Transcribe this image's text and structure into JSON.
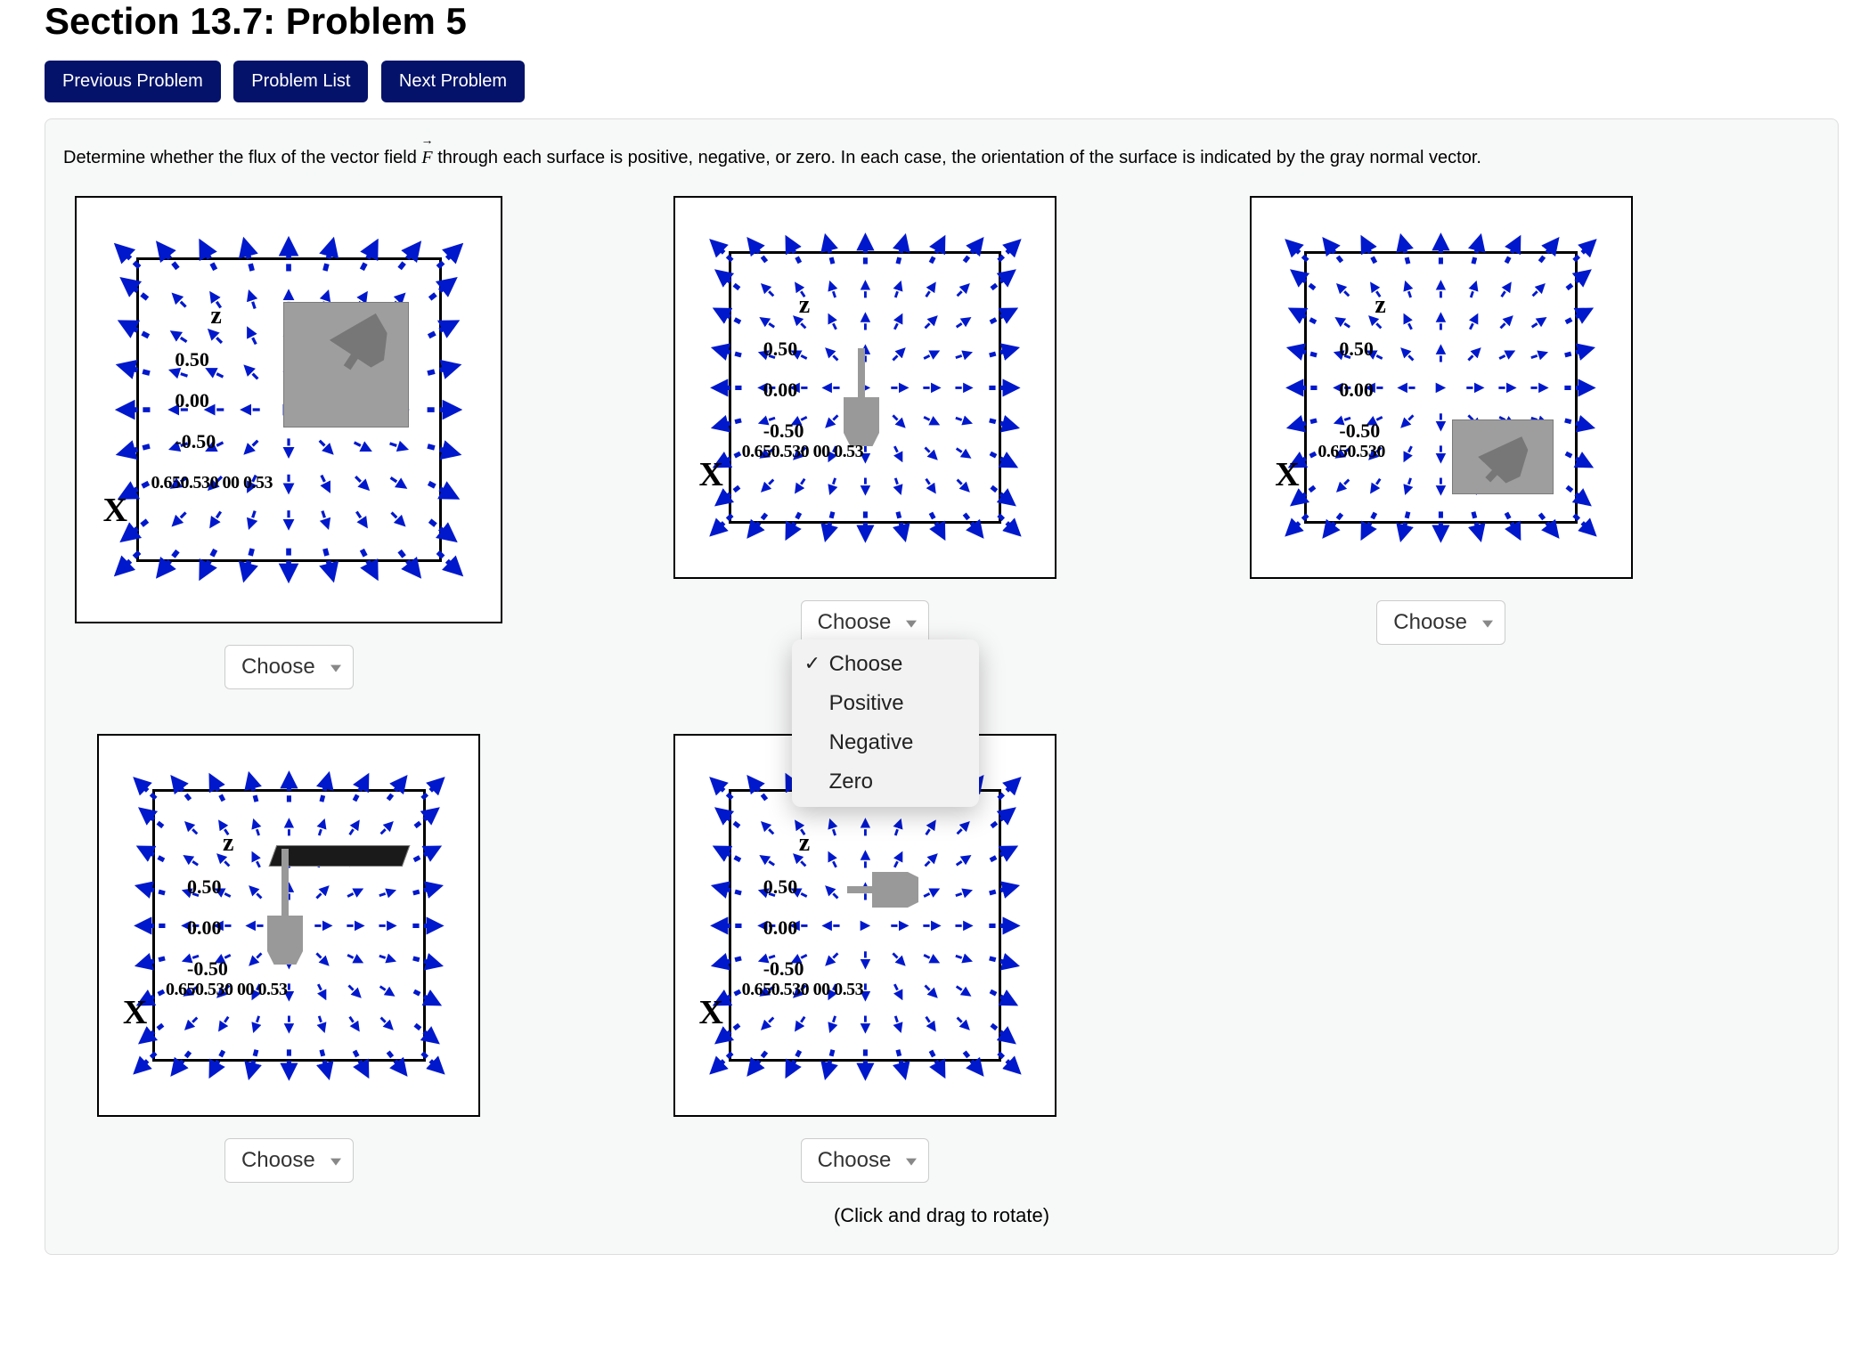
{
  "title": "Section 13.7: Problem 5",
  "nav": {
    "prev": "Previous Problem",
    "list": "Problem List",
    "next": "Next Problem"
  },
  "instructions_pre": "Determine whether the flux of the vector field ",
  "instructions_post": " through each surface is positive, negative, or zero. In each case, the orientation of the surface is indicated by the gray normal vector.",
  "axis_labels": {
    "z": "z",
    "x_big": "X",
    "ticks_z": [
      "0.50",
      "0.00",
      "-0.50"
    ],
    "xy_tick": "0.650.530 00 0.53",
    "xy_tick_short": "0.650.530"
  },
  "dropdown": {
    "placeholder": "Choose",
    "options": [
      "Choose",
      "Positive",
      "Negative",
      "Zero"
    ]
  },
  "footnote": "(Click and drag to rotate)"
}
